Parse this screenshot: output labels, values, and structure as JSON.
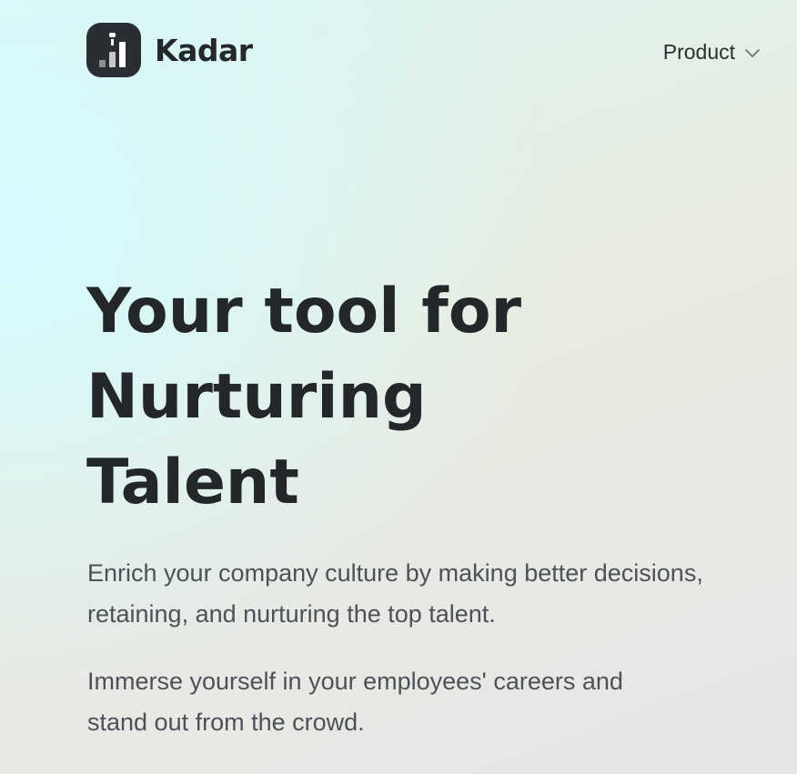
{
  "header": {
    "logo_text": "Kadar",
    "nav": {
      "product_label": "Product"
    }
  },
  "hero": {
    "title_lines": [
      "Your tool for",
      "Nurturing",
      "Talent"
    ],
    "paragraph_1": "Enrich your company culture by making better decisions, retaining, and nurturing the top talent.",
    "paragraph_2": "Immerse yourself in your employees' careers and stand out from the crowd."
  },
  "icons": {
    "logo": "kadar-logo-bar-chart-person-icon",
    "dropdown": "chevron-down-icon"
  },
  "colors": {
    "text_dark": "#25282b",
    "text_muted": "#4c5258",
    "logo_bg": "#2a2d31",
    "bg_cyan": "#d6faff",
    "bg_gray": "#e6e6e6"
  }
}
